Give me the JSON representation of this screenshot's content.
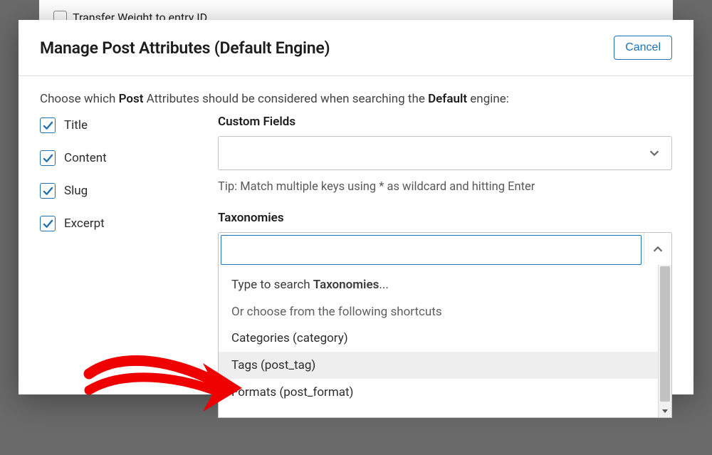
{
  "behind": {
    "checkbox_label": "Transfer Weight to entry ID"
  },
  "header": {
    "title": "Manage Post Attributes (Default Engine)",
    "cancel_label": "Cancel"
  },
  "instruction": {
    "pre": "Choose which ",
    "bold1": "Post",
    "mid": " Attributes should be considered when searching the ",
    "bold2": "Default",
    "post": " engine:"
  },
  "checkboxes": {
    "title": "Title",
    "content": "Content",
    "slug": "Slug",
    "excerpt": "Excerpt"
  },
  "custom_fields": {
    "label": "Custom Fields",
    "tip": "Tip: Match multiple keys using * as wildcard and hitting Enter"
  },
  "taxonomies": {
    "label": "Taxonomies",
    "dropdown": {
      "placeholder_pre": "Type to search ",
      "placeholder_bold": "Taxonomies",
      "placeholder_post": "...",
      "subhead": "Or choose from the following shortcuts",
      "options": [
        "Categories (category)",
        "Tags (post_tag)",
        "Formats (post_format)"
      ],
      "highlighted_index": 1
    }
  },
  "icons": {
    "check_color": "#2271b1"
  }
}
